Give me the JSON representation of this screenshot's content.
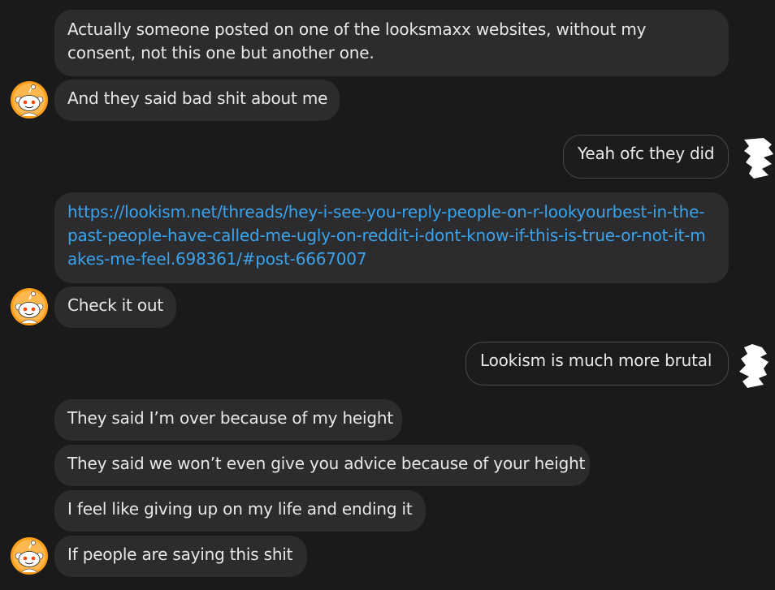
{
  "icons": {
    "avatar": "reddit-snoo-avatar",
    "redacted": "redacted-avatar"
  },
  "colors": {
    "background": "#1a1a1b",
    "incoming_bubble": "#2c2c2e",
    "outgoing_border": "#4a4a4c",
    "text": "#e8e8ea",
    "link": "#3ba3ec",
    "avatar_orange": "#ff9f1a"
  },
  "messages": {
    "m1_line1": "Actually someone posted on one of the looksmaxx websites, without my",
    "m1_line2": "consent, not this one but another one.",
    "m2": "And they said bad shit about me",
    "m3": "Yeah ofc they did",
    "m4_line1": "https://lookism.net/threads/hey-i-see-you-reply-people-on-r-lookyourbest-in-the-",
    "m4_line2": "past-people-have-called-me-ugly-on-reddit-i-dont-know-if-this-is-true-or-not-it-m",
    "m4_line3": "akes-me-feel.698361/#post-6667007",
    "m5": "Check it out",
    "m6": "Lookism is much more brutal",
    "m7": "They said I’m over because of my height",
    "m8": "They said we won’t even give you advice because of your height",
    "m9": "I feel like giving up on my life and ending it",
    "m10": "If people are saying this shit"
  }
}
